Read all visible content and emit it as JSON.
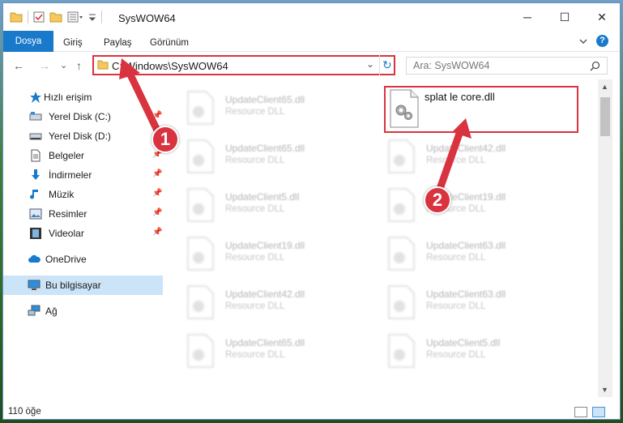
{
  "window": {
    "title": "SysWOW64",
    "minimize_label": "─",
    "maximize_label": "☐",
    "close_label": "✕"
  },
  "ribbon": {
    "tabs": [
      {
        "label": "Dosya"
      },
      {
        "label": "Giriş"
      },
      {
        "label": "Paylaş"
      },
      {
        "label": "Görünüm"
      }
    ],
    "help_label": "?"
  },
  "address": {
    "path": "C:\\Windows\\SysWOW64",
    "back": "←",
    "forward": "→",
    "recent": "⌄",
    "up": "↑",
    "dropdown": "⌄",
    "refresh": "↻"
  },
  "search": {
    "placeholder": "Ara: SysWOW64",
    "icon": "search-icon"
  },
  "sidebar": {
    "items": [
      {
        "label": "Hızlı erişim",
        "icon": "star-icon",
        "pinned": false
      },
      {
        "label": "Yerel Disk (C:)",
        "icon": "drive-icon",
        "pinned": true
      },
      {
        "label": "Yerel Disk (D:)",
        "icon": "drive-icon",
        "pinned": true
      },
      {
        "label": "Belgeler",
        "icon": "document-icon",
        "pinned": true
      },
      {
        "label": "İndirmeler",
        "icon": "download-icon",
        "pinned": true
      },
      {
        "label": "Müzik",
        "icon": "music-icon",
        "pinned": true
      },
      {
        "label": "Resimler",
        "icon": "picture-icon",
        "pinned": true
      },
      {
        "label": "Videolar",
        "icon": "video-icon",
        "pinned": true
      },
      {
        "label": "OneDrive",
        "icon": "cloud-icon",
        "pinned": false
      },
      {
        "label": "Bu bilgisayar",
        "icon": "computer-icon",
        "pinned": false
      },
      {
        "label": "Ağ",
        "icon": "network-icon",
        "pinned": false
      }
    ]
  },
  "files": {
    "left": [
      {
        "name": "UpdateClient65.dll",
        "type": "Resource DLL"
      },
      {
        "name": "UpdateClient65.dll",
        "type": "Resource DLL"
      },
      {
        "name": "UpdateClient5.dll",
        "type": "Resource DLL"
      },
      {
        "name": "UpdateClient19.dll",
        "type": "Resource DLL"
      },
      {
        "name": "UpdateClient42.dll",
        "type": "Resource DLL"
      },
      {
        "name": "UpdateClient65.dll",
        "type": "Resource DLL"
      }
    ],
    "right": [
      {
        "name": "UpdateClient42.dll",
        "type": "Resource DLL"
      },
      {
        "name": "UpdateClient19.dll",
        "type": "Resource DLL"
      },
      {
        "name": "UpdateClient63.dll",
        "type": "Resource DLL"
      },
      {
        "name": "UpdateClient63.dll",
        "type": "Resource DLL"
      },
      {
        "name": "UpdateClient5.dll",
        "type": "Resource DLL"
      }
    ],
    "highlighted": {
      "name": "splat le core.dll"
    }
  },
  "annotations": {
    "marker1": "1",
    "marker2": "2",
    "accent": "#d9333f"
  },
  "status": {
    "count": "110 öğe"
  }
}
